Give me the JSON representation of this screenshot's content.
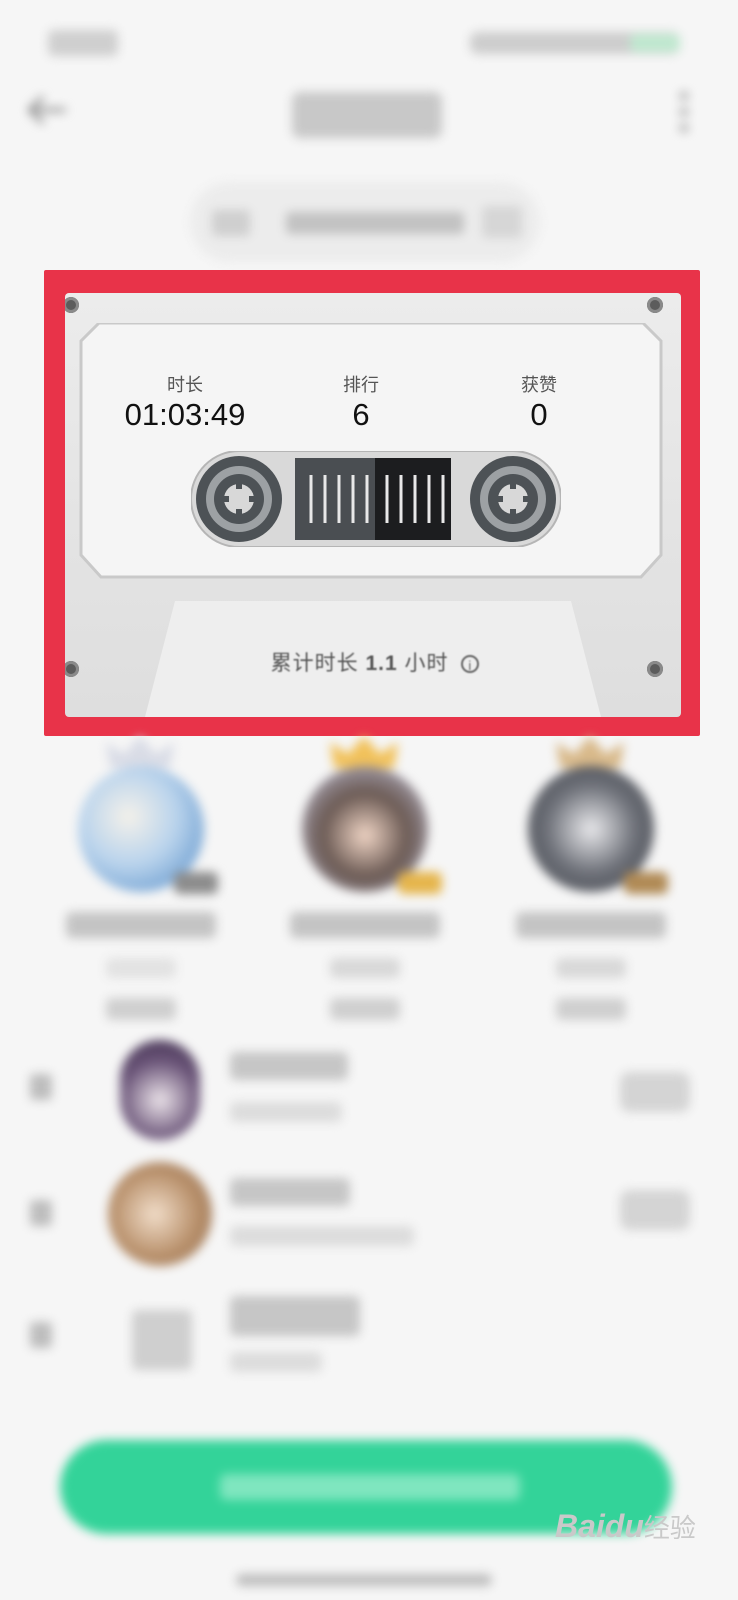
{
  "cassette": {
    "stats": [
      {
        "label": "时长",
        "value": "01:03:49"
      },
      {
        "label": "排行",
        "value": "6"
      },
      {
        "label": "获赞",
        "value": "0"
      }
    ],
    "total_label": "累计时长",
    "total_value": "1.1",
    "total_unit": "小时",
    "info_symbol": "i",
    "highlight_color": "#e83349"
  },
  "action_button": {
    "color": "#33d399"
  },
  "watermark": {
    "brand": "Bai",
    "paw": "du",
    "suffix": "经验"
  },
  "icons": {
    "back": "arrow-left-icon",
    "more": "more-vertical-icon",
    "info": "info-circle-icon",
    "crown": "crown-icon",
    "like": "thumbs-up-icon"
  }
}
